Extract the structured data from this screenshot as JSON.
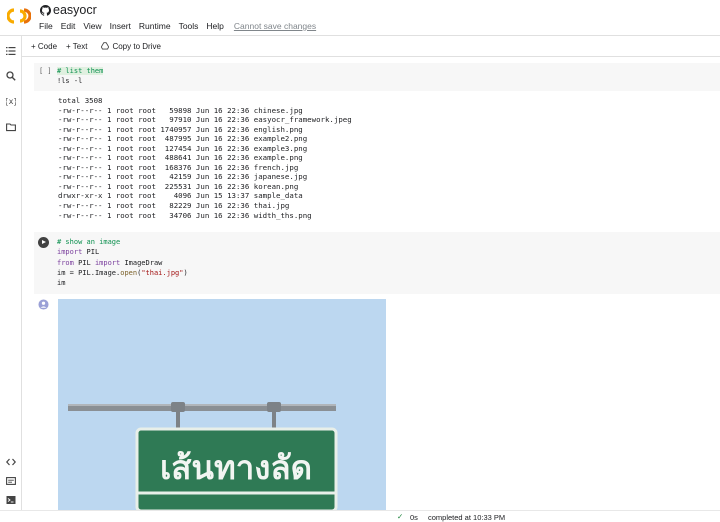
{
  "app": {
    "title": "easyocr",
    "menu": [
      "File",
      "Edit",
      "View",
      "Insert",
      "Runtime",
      "Tools",
      "Help"
    ],
    "save_warning": "Cannot save changes"
  },
  "toolbar": {
    "code_label": "+ Code",
    "text_label": "+ Text",
    "drive_label": "Copy to Drive"
  },
  "cell1": {
    "brackets": "[ ]",
    "comment": "# list them",
    "command": "!ls -l",
    "output": [
      "total 3508",
      "-rw-r--r-- 1 root root   59898 Jun 16 22:36 chinese.jpg",
      "-rw-r--r-- 1 root root   97910 Jun 16 22:36 easyocr_framework.jpeg",
      "-rw-r--r-- 1 root root 1740957 Jun 16 22:36 english.png",
      "-rw-r--r-- 1 root root  487995 Jun 16 22:36 example2.png",
      "-rw-r--r-- 1 root root  127454 Jun 16 22:36 example3.png",
      "-rw-r--r-- 1 root root  488641 Jun 16 22:36 example.png",
      "-rw-r--r-- 1 root root  168376 Jun 16 22:36 french.jpg",
      "-rw-r--r-- 1 root root   42159 Jun 16 22:36 japanese.jpg",
      "-rw-r--r-- 1 root root  225531 Jun 16 22:36 korean.png",
      "drwxr-xr-x 1 root root    4096 Jun 15 13:37 sample_data",
      "-rw-r--r-- 1 root root   82229 Jun 16 22:36 thai.jpg",
      "-rw-r--r-- 1 root root   34706 Jun 16 22:36 width_ths.png"
    ]
  },
  "cell2": {
    "comment": "# show an image",
    "line2_kw": "import",
    "line2_rest": " PIL",
    "line3_kw1": "from",
    "line3_mod": " PIL ",
    "line3_kw2": "import",
    "line3_rest": " ImageDraw",
    "line4_var": "im",
    "line4_mid": " = PIL.Image.",
    "line4_fn": "open",
    "line4_open": "(",
    "line4_str": "\"thai.jpg\"",
    "line4_close": ")",
    "line5": "im"
  },
  "image_output": {
    "sign_text": "เส้นทางลัด"
  },
  "status": {
    "check": "✓",
    "duration": "0s",
    "completed": "completed at 10:33 PM"
  },
  "colors": {
    "sign_green": "#2f7a55",
    "sky": "#bcd7f0",
    "run_button": "#424242"
  }
}
